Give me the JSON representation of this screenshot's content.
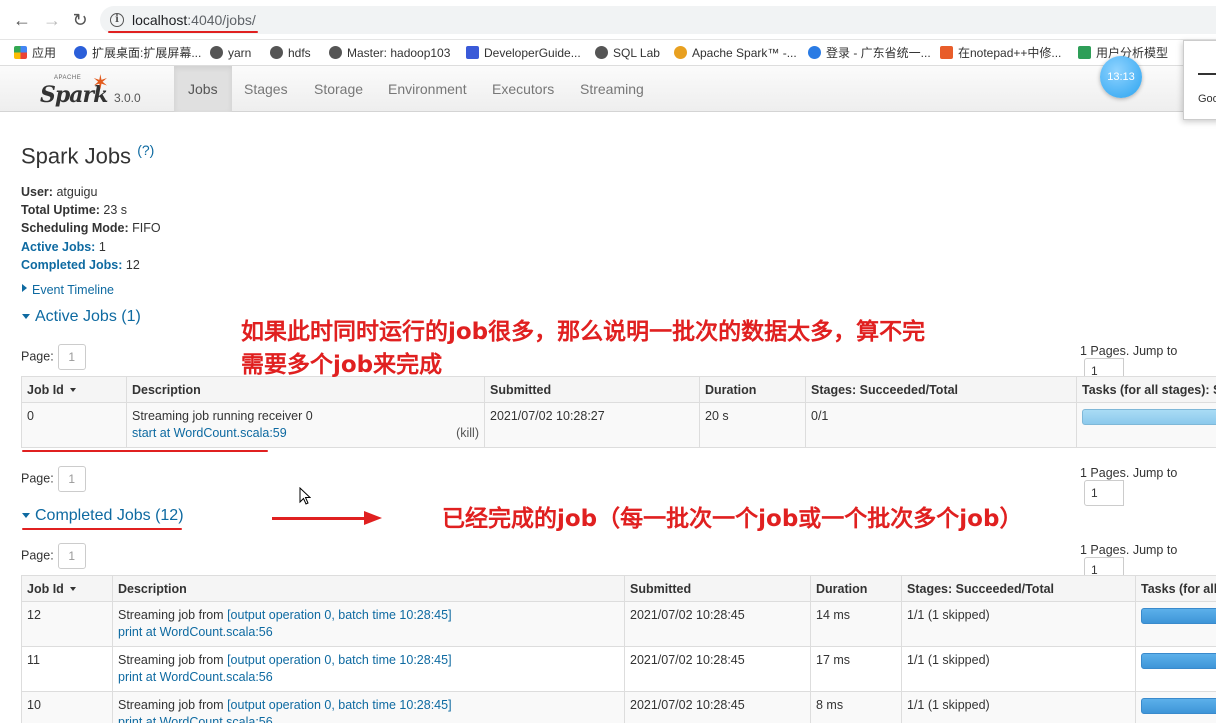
{
  "browser": {
    "url_host": "localhost",
    "url_rest": ":4040/jobs/",
    "bookmarks": [
      "应用",
      "扩展桌面:扩展屏幕...",
      "yarn",
      "hdfs",
      "Master: hadoop103",
      "DeveloperGuide...",
      "SQL Lab",
      "Apache Spark™ -...",
      "登录 - 广东省统一...",
      "在notepad++中修...",
      "用户分析模型"
    ],
    "clock": "13:13",
    "popup_text": "Goo"
  },
  "navbar": {
    "logo_apache": "APACHE",
    "logo_word": "Spark",
    "version": "3.0.0",
    "tabs": [
      "Jobs",
      "Stages",
      "Storage",
      "Environment",
      "Executors",
      "Streaming"
    ]
  },
  "page": {
    "title": "Spark Jobs",
    "help": "(?)",
    "summary": {
      "user_label": "User:",
      "user": "atguigu",
      "uptime_label": "Total Uptime:",
      "uptime": "23 s",
      "sched_label": "Scheduling Mode:",
      "sched": "FIFO",
      "active_label": "Active Jobs:",
      "active": "1",
      "completed_label": "Completed Jobs:",
      "completed": "12"
    },
    "event_timeline": "Event Timeline"
  },
  "active": {
    "heading": "Active Jobs (1)",
    "page_label": "Page:",
    "page_value": "1",
    "pages_text": "1 Pages. Jump to",
    "jump_value": "1",
    "columns": [
      "Job Id",
      "Description",
      "Submitted",
      "Duration",
      "Stages: Succeeded/Total",
      "Tasks (for all stages): Succeeded/Total"
    ],
    "rows": [
      {
        "id": "0",
        "desc_line1": "Streaming job running receiver 0",
        "desc_link": "start at WordCount.scala:59",
        "kill": "(kill)",
        "submitted": "2021/07/02 10:28:27",
        "duration": "20 s",
        "stages": "0/1"
      }
    ]
  },
  "completed": {
    "heading": "Completed Jobs (12)",
    "page_label": "Page:",
    "page_value": "1",
    "pages_text": "1 Pages. Jump to",
    "jump_value": "1",
    "columns": [
      "Job Id",
      "Description",
      "Submitted",
      "Duration",
      "Stages: Succeeded/Total",
      "Tasks (for all stages): Succeeded/Total"
    ],
    "rows": [
      {
        "id": "12",
        "desc_prefix": "Streaming job from ",
        "desc_batch": "[output operation 0, batch time 10:28:45]",
        "desc_link": "print at WordCount.scala:56",
        "submitted": "2021/07/02 10:28:45",
        "duration": "14 ms",
        "stages": "1/1 (1 skipped)"
      },
      {
        "id": "11",
        "desc_prefix": "Streaming job from ",
        "desc_batch": "[output operation 0, batch time 10:28:45]",
        "desc_link": "print at WordCount.scala:56",
        "submitted": "2021/07/02 10:28:45",
        "duration": "17 ms",
        "stages": "1/1 (1 skipped)"
      },
      {
        "id": "10",
        "desc_prefix": "Streaming job from ",
        "desc_batch": "[output operation 0, batch time 10:28:45]",
        "desc_link": "print at WordCount.scala:56",
        "submitted": "2021/07/02 10:28:45",
        "duration": "8 ms",
        "stages": "1/1 (1 skipped)"
      }
    ]
  },
  "annotations": {
    "note1_line1": "如果此时同时运行的job很多，那么说明一批次的数据太多，算不完",
    "note1_line2": "需要多个job来完成",
    "note2": "已经完成的job（每一批次一个job或一个批次多个job）"
  }
}
